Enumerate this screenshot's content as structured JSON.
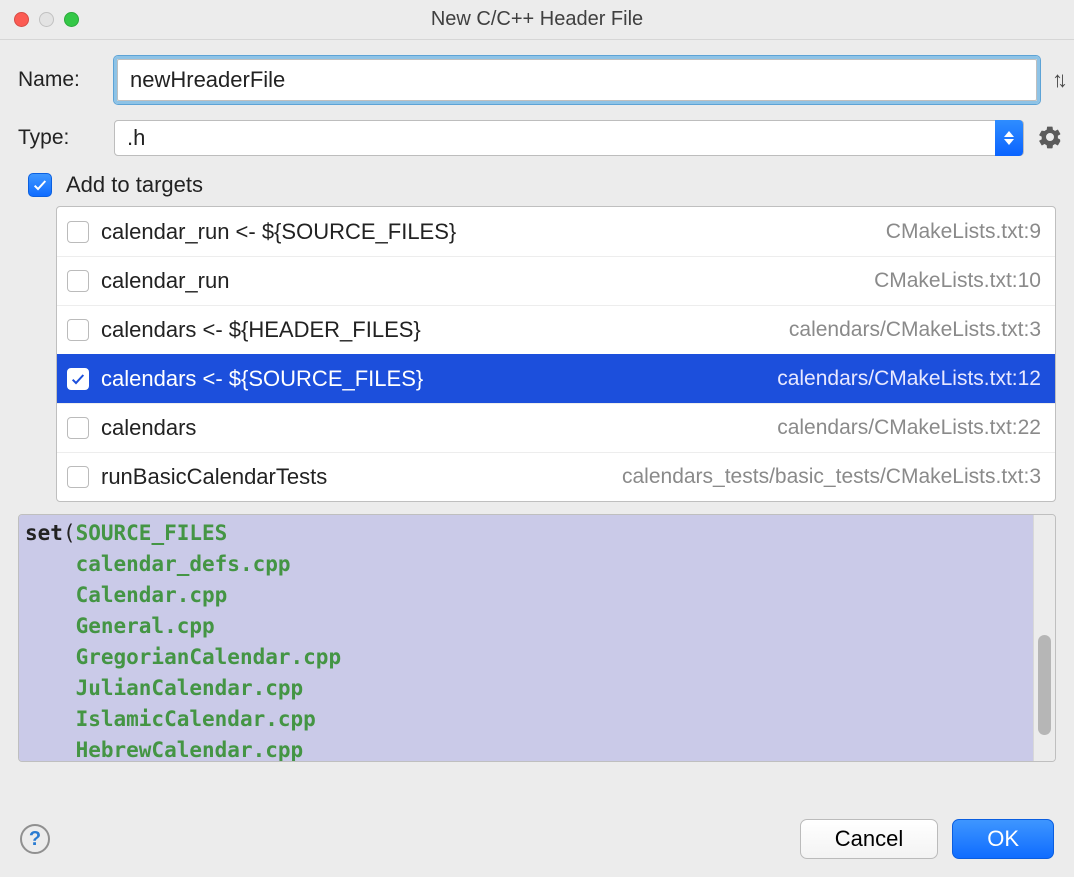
{
  "title": "New C/C++ Header File",
  "name": {
    "label": "Name:",
    "value": "newHreaderFile"
  },
  "type": {
    "label": "Type:",
    "value": ".h"
  },
  "addToTargets": {
    "label": "Add to targets",
    "checked": true
  },
  "targets": [
    {
      "label": "calendar_run <- ${SOURCE_FILES}",
      "path": "CMakeLists.txt:9",
      "checked": false,
      "selected": false
    },
    {
      "label": "calendar_run",
      "path": "CMakeLists.txt:10",
      "checked": false,
      "selected": false
    },
    {
      "label": "calendars <- ${HEADER_FILES}",
      "path": "calendars/CMakeLists.txt:3",
      "checked": false,
      "selected": false
    },
    {
      "label": "calendars <- ${SOURCE_FILES}",
      "path": "calendars/CMakeLists.txt:12",
      "checked": true,
      "selected": true
    },
    {
      "label": "calendars",
      "path": "calendars/CMakeLists.txt:22",
      "checked": false,
      "selected": false
    },
    {
      "label": "runBasicCalendarTests",
      "path": "calendars_tests/basic_tests/CMakeLists.txt:3",
      "checked": false,
      "selected": false
    }
  ],
  "code": {
    "keyword": "set",
    "firstIdent": "SOURCE_FILES",
    "files": [
      "calendar_defs.cpp",
      "Calendar.cpp",
      "General.cpp",
      "GregorianCalendar.cpp",
      "JulianCalendar.cpp",
      "IslamicCalendar.cpp",
      "HebrewCalendar.cpp"
    ],
    "trailing": ")"
  },
  "buttons": {
    "cancel": "Cancel",
    "ok": "OK"
  }
}
